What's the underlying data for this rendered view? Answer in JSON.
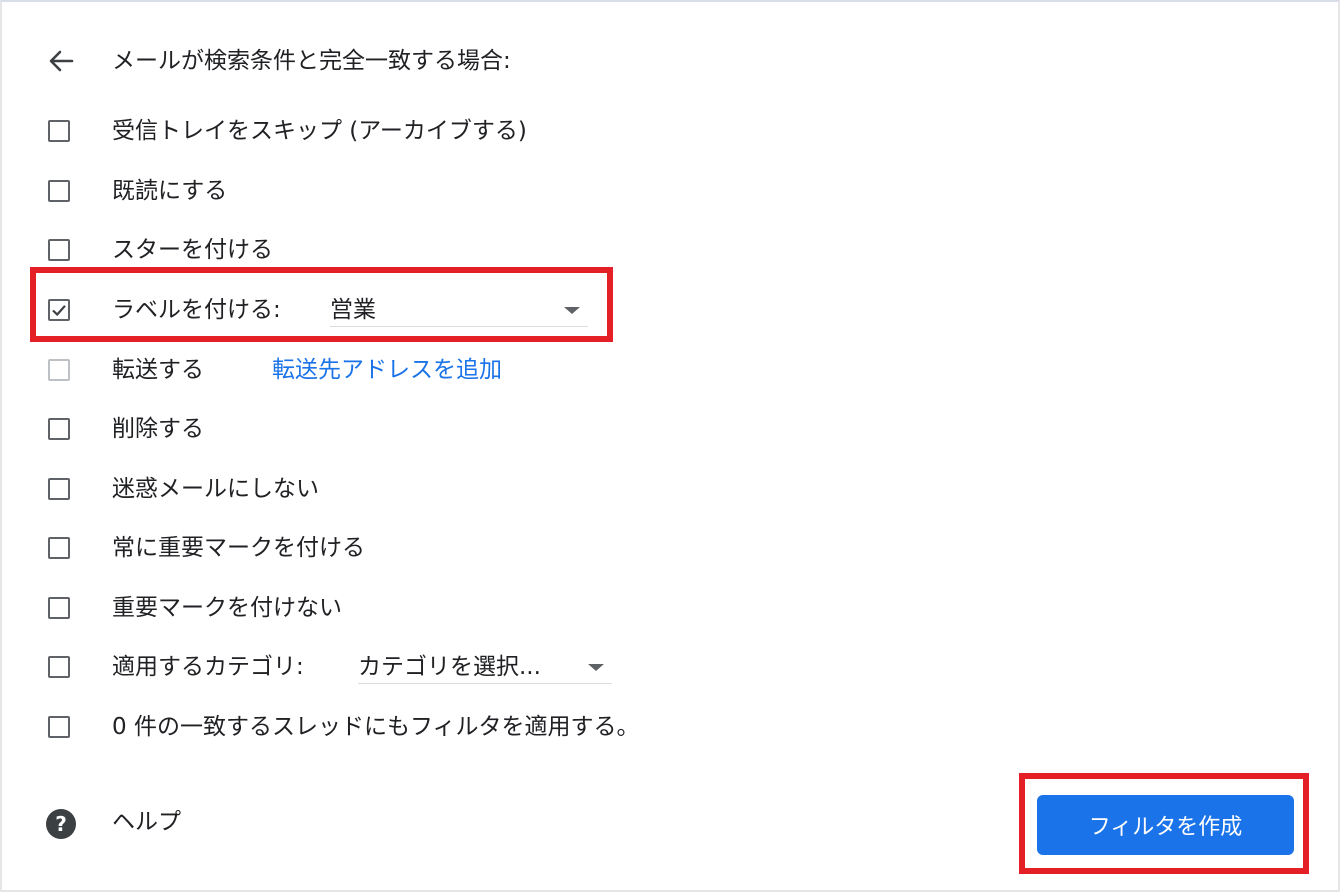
{
  "header": {
    "title": "メールが検索条件と完全一致する場合:",
    "back_icon": "arrow-left-icon"
  },
  "options": [
    {
      "label": "受信トレイをスキップ (アーカイブする)",
      "checked": false
    },
    {
      "label": "既読にする",
      "checked": false
    },
    {
      "label": "スターを付ける",
      "checked": false
    },
    {
      "label": "ラベルを付ける:",
      "checked": true,
      "select_value": "営業"
    },
    {
      "label": "転送する",
      "checked": false,
      "disabled": true,
      "link": "転送先アドレスを追加"
    },
    {
      "label": "削除する",
      "checked": false
    },
    {
      "label": "迷惑メールにしない",
      "checked": false
    },
    {
      "label": "常に重要マークを付ける",
      "checked": false
    },
    {
      "label": "重要マークを付けない",
      "checked": false
    },
    {
      "label": "適用するカテゴリ:",
      "checked": false,
      "select_value": "カテゴリを選択..."
    },
    {
      "label": "0 件の一致するスレッドにもフィルタを適用する。",
      "checked": false
    }
  ],
  "footer": {
    "help_label": "ヘルプ",
    "help_icon": "help-circle-icon",
    "create_button": "フィルタを作成"
  },
  "colors": {
    "accent": "#1a73e8",
    "highlight": "#e41f26",
    "text": "#202124"
  }
}
